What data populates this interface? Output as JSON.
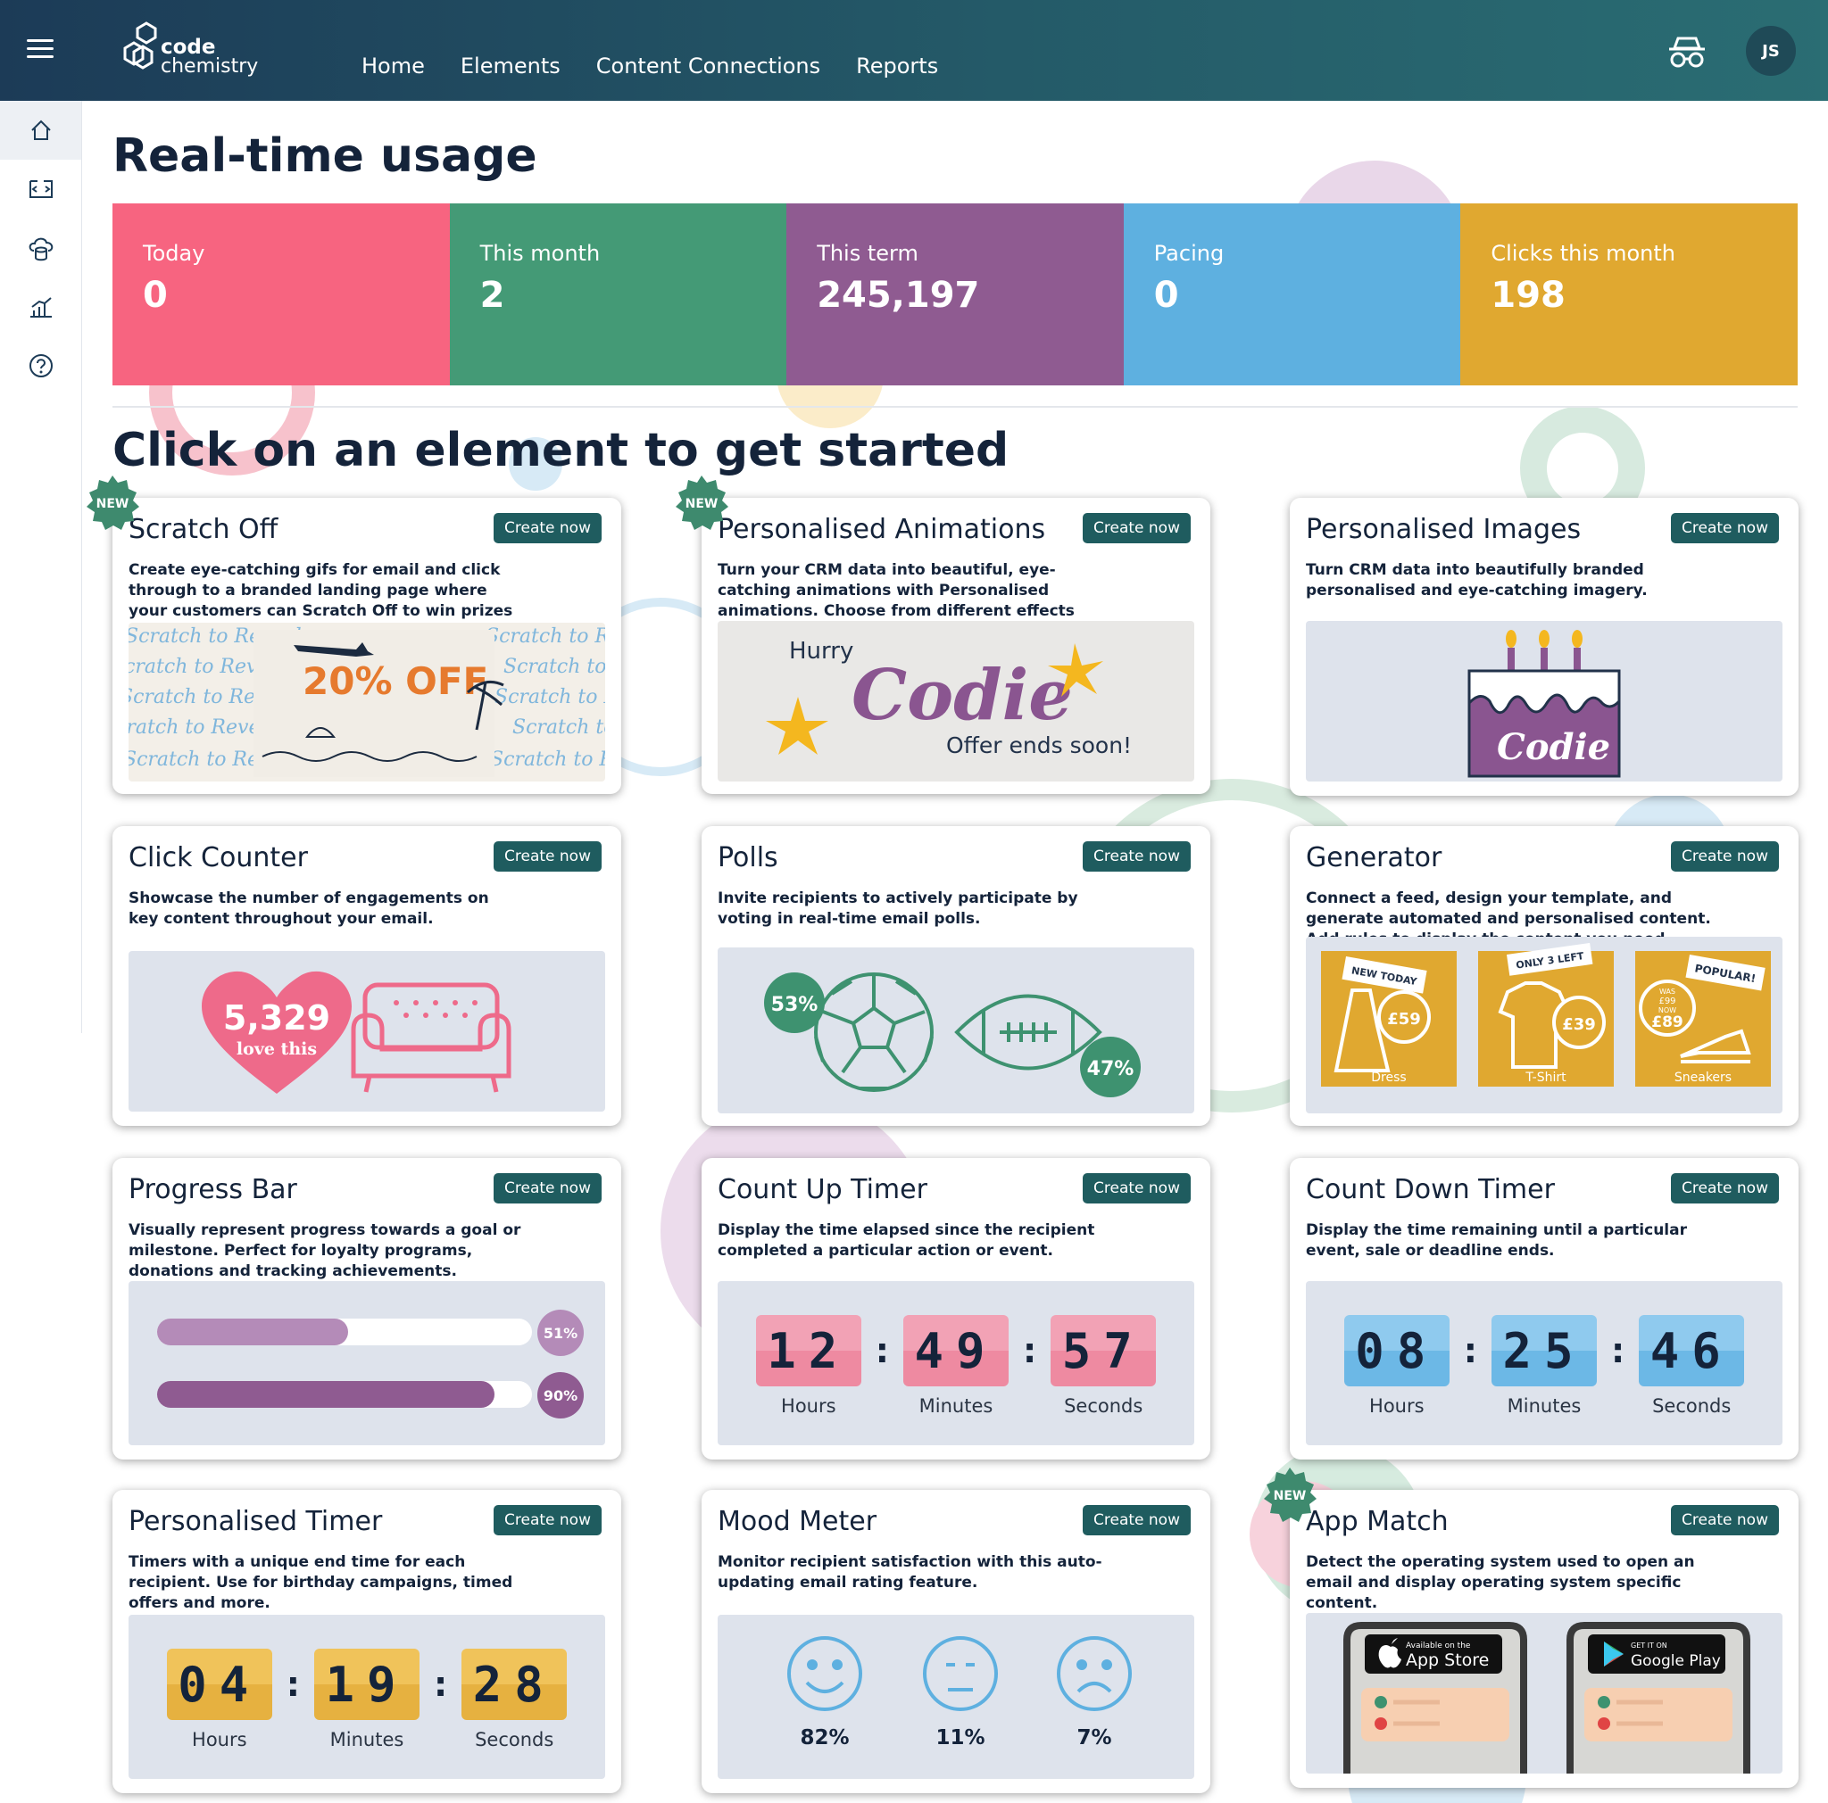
{
  "brand": {
    "logo_line1": "code",
    "logo_line2": "chemistry"
  },
  "nav": {
    "home": "Home",
    "elements": "Elements",
    "content_connections": "Content Connections",
    "reports": "Reports"
  },
  "user": {
    "initials": "JS"
  },
  "page": {
    "title": "Real-time usage",
    "subtitle": "Click on an element to get started"
  },
  "stats": [
    {
      "label": "Today",
      "value": "0",
      "color": "#f76480"
    },
    {
      "label": "This month",
      "value": "2",
      "color": "#449a76"
    },
    {
      "label": "This term",
      "value": "245,197",
      "color": "#8f5b91"
    },
    {
      "label": "Pacing",
      "value": "0",
      "color": "#5eb0e0"
    },
    {
      "label": "Clicks this month",
      "value": "198",
      "color": "#e0a830"
    }
  ],
  "create_label": "Create now",
  "new_label": "NEW",
  "cards": {
    "scratch": {
      "title": "Scratch Off",
      "desc": "Create eye-catching gifs for email and click through to a branded landing page where your customers can Scratch Off to win prizes and",
      "promo": "20% OFF",
      "bg_text": "Scratch to Reveal"
    },
    "animations": {
      "title": "Personalised Animations",
      "desc": "Turn your CRM data into beautiful, eye-catching animations with Personalised animations. Choose from different effects",
      "hurry": "Hurry",
      "name": "Codie",
      "offer": "Offer ends soon!"
    },
    "images": {
      "title": "Personalised Images",
      "desc": "Turn CRM data into beautifully branded personalised and eye-catching imagery.",
      "cake_name": "Codie"
    },
    "clicks": {
      "title": "Click Counter",
      "desc": "Showcase the number of engagements on key content throughout your email.",
      "count": "5,329",
      "love": "love this"
    },
    "polls": {
      "title": "Polls",
      "desc": "Invite recipients to actively participate by voting in real-time email polls.",
      "left": "53%",
      "right": "47%"
    },
    "generator": {
      "title": "Generator",
      "desc": "Connect a feed, design your template, and generate automated and personalised content. Add rules to display the content you need.",
      "products": [
        {
          "tag": "NEW TODAY",
          "price": "£59",
          "name": "Dress"
        },
        {
          "tag": "ONLY 3 LEFT",
          "price": "£39",
          "name": "T-Shirt"
        },
        {
          "tag": "POPULAR!",
          "was": "WAS",
          "was_price": "£99",
          "now": "NOW",
          "price": "£89",
          "name": "Sneakers"
        }
      ]
    },
    "progress": {
      "title": "Progress Bar",
      "desc": "Visually represent progress towards a goal or milestone. Perfect for loyalty programs, donations and tracking achievements.",
      "bar1": "51%",
      "bar1_value": 0.51,
      "bar2": "90%",
      "bar2_value": 0.9
    },
    "countup": {
      "title": "Count Up Timer",
      "desc": "Display the time elapsed since the recipient completed a particular action or event.",
      "h": "12",
      "m": "49",
      "s": "57"
    },
    "countdown": {
      "title": "Count Down Timer",
      "desc": "Display the time remaining until a particular event, sale or deadline ends.",
      "h": "08",
      "m": "25",
      "s": "46"
    },
    "ptimer": {
      "title": "Personalised Timer",
      "desc": "Timers with a unique end time for each recipient. Use for birthday campaigns, timed offers and more.",
      "h": "04",
      "m": "19",
      "s": "28"
    },
    "mood": {
      "title": "Mood Meter",
      "desc": "Monitor recipient satisfaction with this auto-updating email rating feature.",
      "happy": "82%",
      "neutral": "11%",
      "sad": "7%"
    },
    "appmatch": {
      "title": "App Match",
      "desc": "Detect the operating system used to open an email and display operating system specific content.",
      "apple_small": "Available on the",
      "apple_big": "App Store",
      "google_small": "GET IT ON",
      "google_big": "Google Play"
    }
  },
  "timer_labels": {
    "h": "Hours",
    "m": "Minutes",
    "s": "Seconds"
  }
}
